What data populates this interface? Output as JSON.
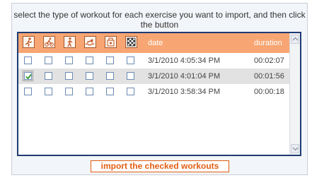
{
  "instructions": "select the type of workout for each exercise you want to import, and then click the button",
  "header": {
    "icons": [
      "running-icon",
      "cycling-icon",
      "walking-icon",
      "swimming-icon",
      "other-sport-icon",
      "race-flag-icon"
    ],
    "date_label": "date",
    "duration_label": "duration"
  },
  "workouts": [
    {
      "date": "3/1/2010 4:05:34 PM",
      "duration": "00:02:07",
      "checked_index": -1,
      "selected": false
    },
    {
      "date": "3/1/2010 4:01:04 PM",
      "duration": "00:01:56",
      "checked_index": 0,
      "selected": true
    },
    {
      "date": "3/1/2010 3:58:34 PM",
      "duration": "00:00:18",
      "checked_index": -1,
      "selected": false
    }
  ],
  "import_button_label": "import the checked workouts",
  "colors": {
    "header_bg": "#f7a673",
    "panel_border": "#1f3b73",
    "button_accent": "#e35d12"
  }
}
